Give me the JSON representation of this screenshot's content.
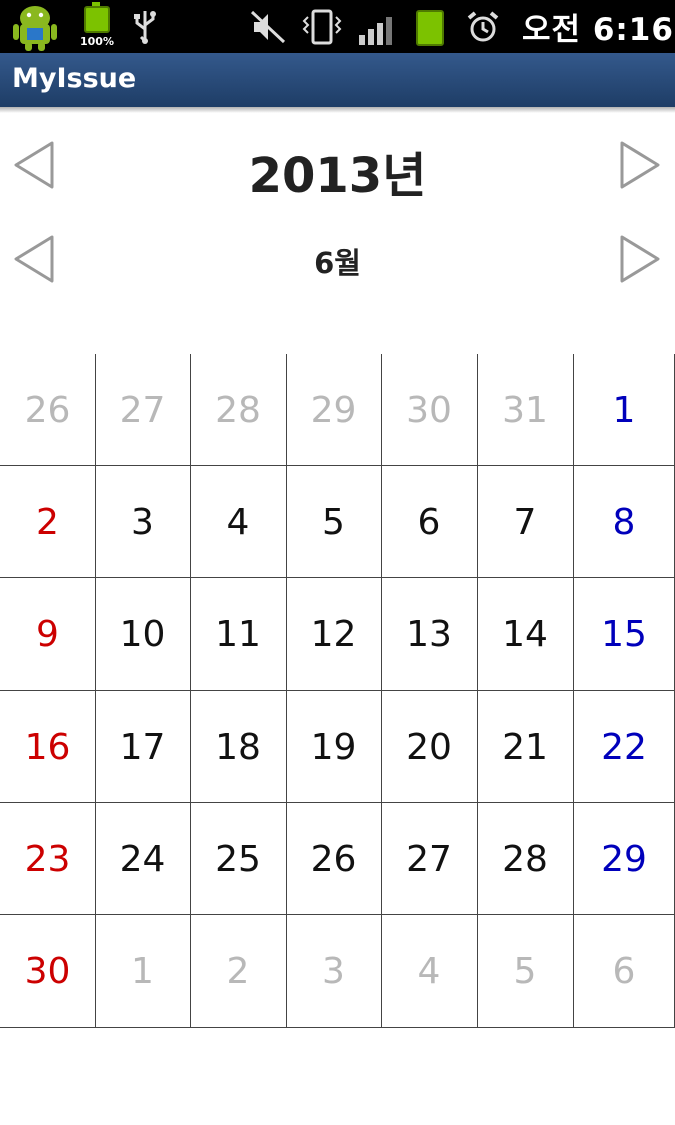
{
  "status_bar": {
    "battery_notification_percent": "100%",
    "time": "오전 6:16",
    "icons": [
      "android-robot-icon",
      "battery-notification-icon",
      "usb-icon",
      "mute-icon",
      "vibrate-icon",
      "signal-icon",
      "battery-icon",
      "alarm-icon"
    ]
  },
  "app": {
    "title": "MyIssue"
  },
  "nav": {
    "year": "2013년",
    "month": "6월"
  },
  "calendar": {
    "weeks": [
      [
        {
          "d": "26",
          "t": "other"
        },
        {
          "d": "27",
          "t": "other"
        },
        {
          "d": "28",
          "t": "other"
        },
        {
          "d": "29",
          "t": "other"
        },
        {
          "d": "30",
          "t": "other"
        },
        {
          "d": "31",
          "t": "other"
        },
        {
          "d": "1",
          "t": "sat"
        }
      ],
      [
        {
          "d": "2",
          "t": "sun"
        },
        {
          "d": "3",
          "t": "norm"
        },
        {
          "d": "4",
          "t": "norm"
        },
        {
          "d": "5",
          "t": "norm"
        },
        {
          "d": "6",
          "t": "norm"
        },
        {
          "d": "7",
          "t": "norm"
        },
        {
          "d": "8",
          "t": "sat"
        }
      ],
      [
        {
          "d": "9",
          "t": "sun"
        },
        {
          "d": "10",
          "t": "norm"
        },
        {
          "d": "11",
          "t": "norm"
        },
        {
          "d": "12",
          "t": "norm"
        },
        {
          "d": "13",
          "t": "norm"
        },
        {
          "d": "14",
          "t": "norm"
        },
        {
          "d": "15",
          "t": "sat"
        }
      ],
      [
        {
          "d": "16",
          "t": "sun"
        },
        {
          "d": "17",
          "t": "norm"
        },
        {
          "d": "18",
          "t": "norm"
        },
        {
          "d": "19",
          "t": "norm"
        },
        {
          "d": "20",
          "t": "norm"
        },
        {
          "d": "21",
          "t": "norm"
        },
        {
          "d": "22",
          "t": "sat"
        }
      ],
      [
        {
          "d": "23",
          "t": "sun"
        },
        {
          "d": "24",
          "t": "norm"
        },
        {
          "d": "25",
          "t": "norm"
        },
        {
          "d": "26",
          "t": "norm"
        },
        {
          "d": "27",
          "t": "norm"
        },
        {
          "d": "28",
          "t": "norm"
        },
        {
          "d": "29",
          "t": "sat"
        }
      ],
      [
        {
          "d": "30",
          "t": "sun"
        },
        {
          "d": "1",
          "t": "other"
        },
        {
          "d": "2",
          "t": "other"
        },
        {
          "d": "3",
          "t": "other"
        },
        {
          "d": "4",
          "t": "other"
        },
        {
          "d": "5",
          "t": "other"
        },
        {
          "d": "6",
          "t": "other"
        }
      ]
    ],
    "colors": {
      "sunday": "#cc0000",
      "saturday": "#0000bb",
      "other_month": "#b8b8b8",
      "normal": "#111111"
    }
  }
}
